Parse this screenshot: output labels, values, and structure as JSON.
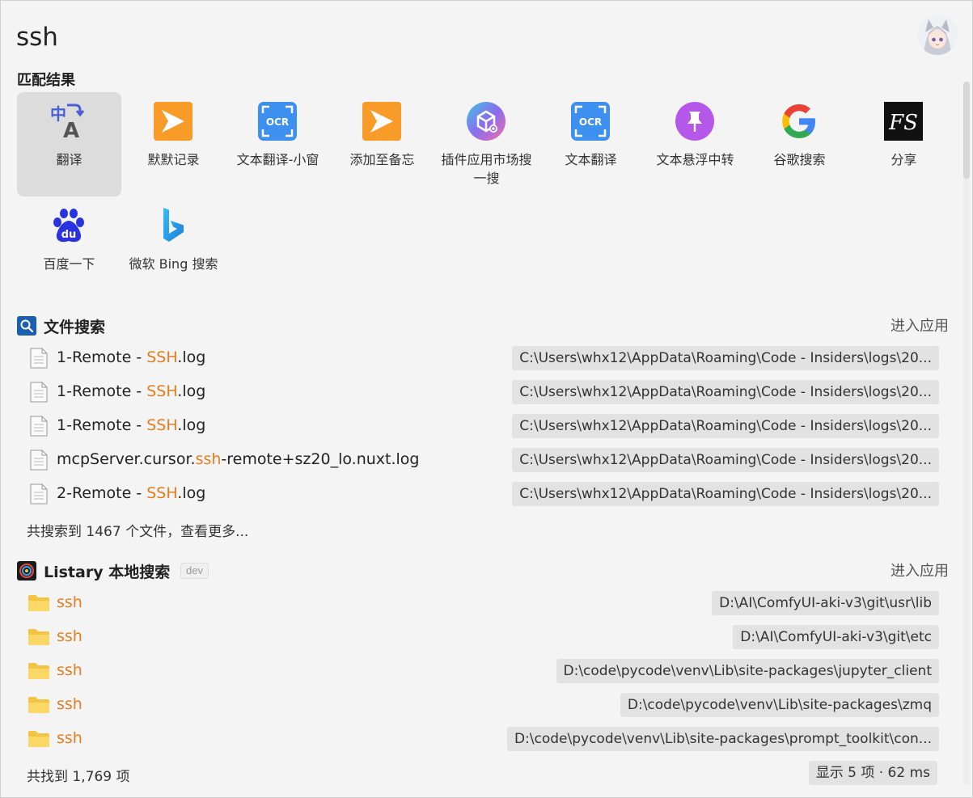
{
  "search": {
    "query": "ssh"
  },
  "match_section": {
    "title": "匹配结果"
  },
  "apps": [
    {
      "label": "翻译",
      "icon": "translate-icon",
      "selected": true
    },
    {
      "label": "默默记录",
      "icon": "note-arrow-icon"
    },
    {
      "label": "文本翻译-小窗",
      "icon": "ocr-icon"
    },
    {
      "label": "添加至备忘",
      "icon": "note-arrow-icon"
    },
    {
      "label": "插件应用市场搜一搜",
      "icon": "plugin-market-icon"
    },
    {
      "label": "文本翻译",
      "icon": "ocr-icon"
    },
    {
      "label": "文本悬浮中转",
      "icon": "pin-icon"
    },
    {
      "label": "谷歌搜索",
      "icon": "google-icon"
    },
    {
      "label": "分享",
      "icon": "fs-share-icon"
    },
    {
      "label": "百度一下",
      "icon": "baidu-icon"
    },
    {
      "label": "微软 Bing 搜索",
      "icon": "bing-icon"
    }
  ],
  "file_search": {
    "title": "文件搜索",
    "action": "进入应用",
    "results": [
      {
        "prefix": "1-Remote - ",
        "match": "SSH",
        "suffix": ".log",
        "path": "C:\\Users\\whx12\\AppData\\Roaming\\Code - Insiders\\logs\\20..."
      },
      {
        "prefix": "1-Remote - ",
        "match": "SSH",
        "suffix": ".log",
        "path": "C:\\Users\\whx12\\AppData\\Roaming\\Code - Insiders\\logs\\20..."
      },
      {
        "prefix": "1-Remote - ",
        "match": "SSH",
        "suffix": ".log",
        "path": "C:\\Users\\whx12\\AppData\\Roaming\\Code - Insiders\\logs\\20..."
      },
      {
        "prefix": "mcpServer.cursor.",
        "match": "ssh",
        "suffix": "-remote+sz20_lo.nuxt.log",
        "path": "C:\\Users\\whx12\\AppData\\Roaming\\Code - Insiders\\logs\\20..."
      },
      {
        "prefix": "2-Remote - ",
        "match": "SSH",
        "suffix": ".log",
        "path": "C:\\Users\\whx12\\AppData\\Roaming\\Code - Insiders\\logs\\20..."
      }
    ],
    "summary": "共搜索到 1467 个文件，查看更多..."
  },
  "listary": {
    "title": "Listary 本地搜索",
    "badge": "dev",
    "action": "进入应用",
    "results": [
      {
        "name": "ssh",
        "path": "D:\\AI\\ComfyUI-aki-v3\\git\\usr\\lib"
      },
      {
        "name": "ssh",
        "path": "D:\\AI\\ComfyUI-aki-v3\\git\\etc"
      },
      {
        "name": "ssh",
        "path": "D:\\code\\pycode\\venv\\Lib\\site-packages\\jupyter_client"
      },
      {
        "name": "ssh",
        "path": "D:\\code\\pycode\\venv\\Lib\\site-packages\\zmq"
      },
      {
        "name": "ssh",
        "path": "D:\\code\\pycode\\venv\\Lib\\site-packages\\prompt_toolkit\\con..."
      }
    ],
    "summary": "共找到 1,769 项",
    "timing": "显示 5 项 · 62 ms"
  },
  "colors": {
    "highlight": "#e57e1e",
    "accent_blue": "#1a5fb4"
  }
}
